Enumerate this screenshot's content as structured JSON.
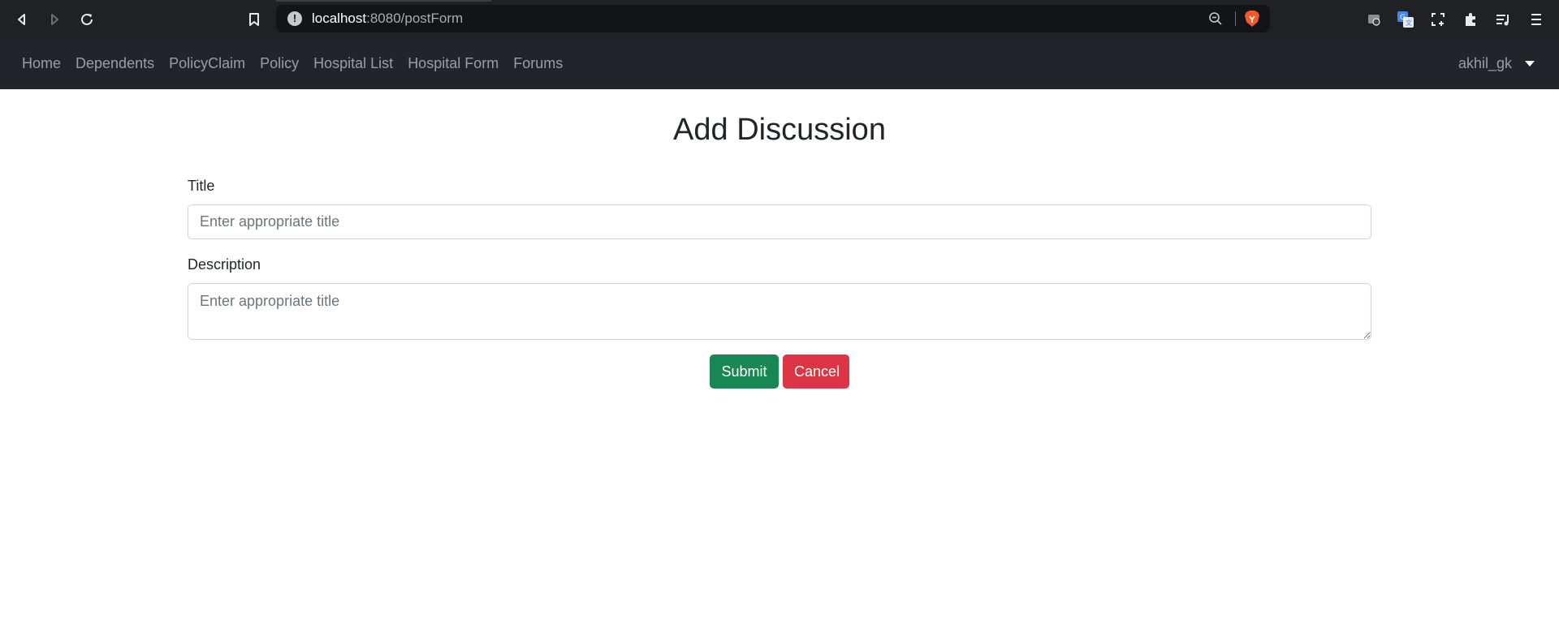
{
  "browser": {
    "url_host": "localhost",
    "url_path": ":8080/postForm",
    "toolbar_icons": [
      "back-icon",
      "forward-icon",
      "reload-icon",
      "bookmark-icon",
      "site-info-icon",
      "zoom-icon",
      "brave-shield-icon",
      "extension-cast-icon",
      "translate-icon",
      "screenshot-icon",
      "puzzle-extensions-icon",
      "reading-list-icon",
      "menu-icon"
    ]
  },
  "navbar": {
    "links": [
      "Home",
      "Dependents",
      "PolicyClaim",
      "Policy",
      "Hospital List",
      "Hospital Form",
      "Forums"
    ],
    "user": "akhil_gk"
  },
  "form": {
    "heading": "Add Discussion",
    "title_label": "Title",
    "title_placeholder": "Enter appropriate title",
    "title_value": "",
    "description_label": "Description",
    "description_placeholder": "Enter appropriate title",
    "description_value": "",
    "submit_label": "Submit",
    "cancel_label": "Cancel"
  },
  "colors": {
    "navbar_bg": "#212529",
    "browser_bg": "#202124",
    "submit": "#198754",
    "cancel": "#dc3545"
  }
}
